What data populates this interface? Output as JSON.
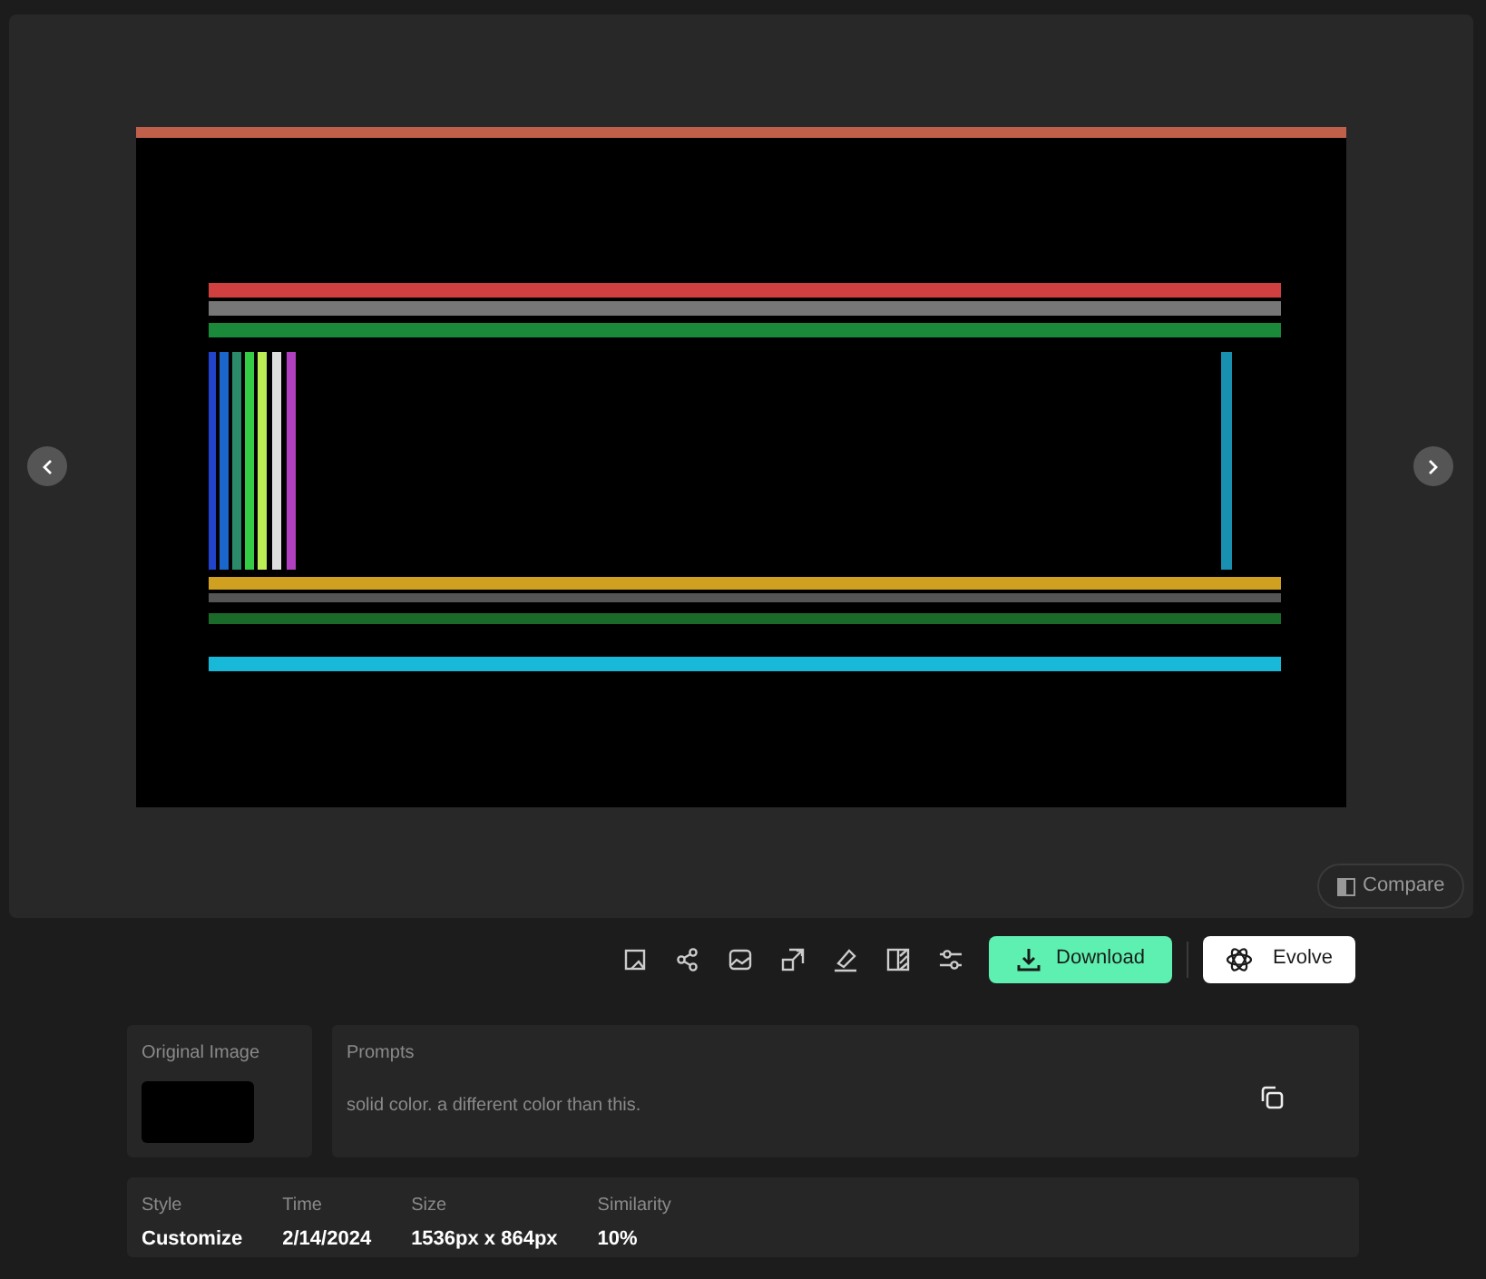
{
  "viewer": {
    "compare_label": "Compare"
  },
  "toolbar": {
    "download_label": "Download",
    "evolve_label": "Evolve"
  },
  "original_image": {
    "label": "Original Image"
  },
  "prompts": {
    "label": "Prompts",
    "text": "solid color. a different color than this."
  },
  "details": [
    {
      "label": "Style",
      "value": "Customize"
    },
    {
      "label": "Time",
      "value": "2/14/2024"
    },
    {
      "label": "Size",
      "value": "1536px x 864px"
    },
    {
      "label": "Similarity",
      "value": "10%"
    }
  ]
}
